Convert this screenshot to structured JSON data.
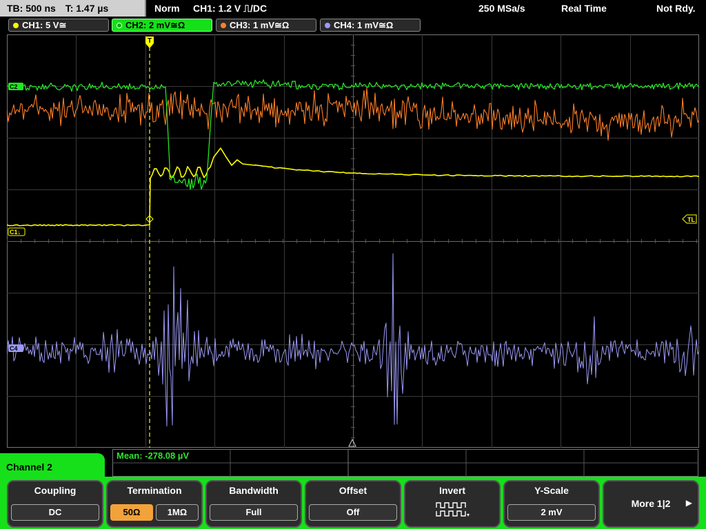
{
  "topbar": {
    "timebase": "TB: 500 ns",
    "trigger_time": "T: 1.47 µs",
    "trigger_mode": "Norm",
    "trigger_info": "CH1: 1.2 V ⎍/DC",
    "sample_rate": "250 MSa/s",
    "acq_mode": "Real Time",
    "status": "Not Rdy."
  },
  "channels": [
    {
      "label": "CH1: 5 V≅",
      "color": "#ffff00",
      "active": false
    },
    {
      "label": "CH2: 2 mV≅Ω",
      "color": "#22e622",
      "active": true
    },
    {
      "label": "CH3: 1 mV≅Ω",
      "color": "#ff7f27",
      "active": false
    },
    {
      "label": "CH4: 1 mV≅Ω",
      "color": "#9b99f5",
      "active": false
    }
  ],
  "markers": {
    "c2": "C2",
    "c1": "C1↓",
    "c4": "C4",
    "tl": "TL"
  },
  "measurement": {
    "mean": "Mean: -278.08 µV"
  },
  "menu": {
    "title": "Channel 2",
    "coupling_title": "Coupling",
    "coupling_value": "DC",
    "termination_title": "Termination",
    "termination_50": "50Ω",
    "termination_1m": "1MΩ",
    "termination_selected": "50Ω",
    "bandwidth_title": "Bandwidth",
    "bandwidth_value": "Full",
    "offset_title": "Offset",
    "offset_value": "Off",
    "invert_title": "Invert",
    "yscale_title": "Y-Scale",
    "yscale_value": "2 mV",
    "more_label": "More 1|2"
  },
  "colors": {
    "ch1": "#ffff00",
    "ch2": "#22e622",
    "ch3": "#ff7f27",
    "ch4": "#9b99f5",
    "menu_accent": "#16e01a",
    "selected_softkey": "#f3a23a"
  }
}
